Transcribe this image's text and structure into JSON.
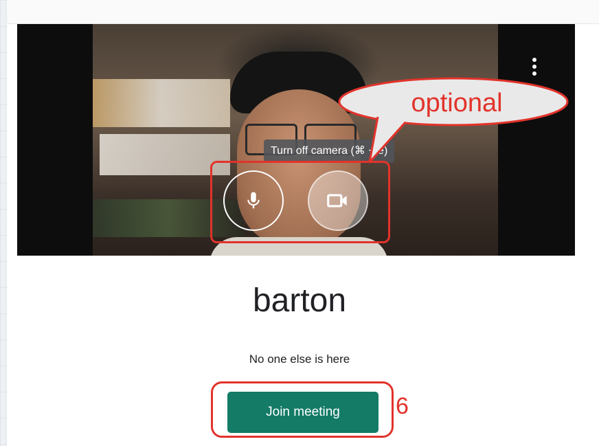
{
  "preview": {
    "more_options_icon": "more-vert-icon",
    "tooltip": "Turn off camera (⌘ + e)",
    "mic_icon": "microphone-icon",
    "camera_icon": "videocam-icon"
  },
  "annotations": {
    "callout_text": "optional",
    "step_number": "6",
    "color": "#e2332b"
  },
  "meeting": {
    "name": "barton",
    "status": "No one else is here",
    "join_label": "Join meeting"
  },
  "colors": {
    "join_button": "#137b66",
    "text": "#202124"
  }
}
